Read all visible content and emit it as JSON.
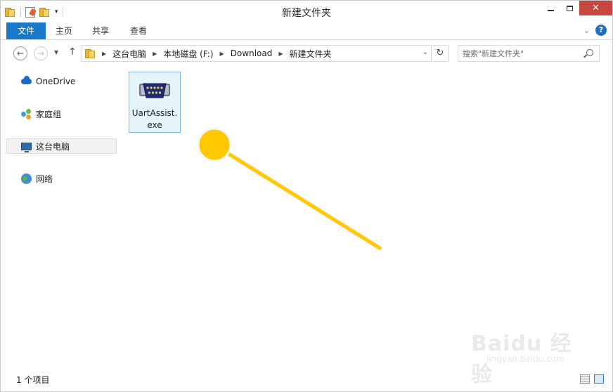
{
  "window": {
    "title": "新建文件夹"
  },
  "ribbon": {
    "tabs": [
      "文件",
      "主页",
      "共享",
      "查看"
    ],
    "help": "?"
  },
  "navigation": {
    "breadcrumbs": [
      "这台电脑",
      "本地磁盘 (F:)",
      "Download",
      "新建文件夹"
    ],
    "search_placeholder": "搜索\"新建文件夹\""
  },
  "sidebar": {
    "items": [
      {
        "label": "OneDrive",
        "icon": "onedrive-icon",
        "selected": false
      },
      {
        "label": "家庭组",
        "icon": "homegroup-icon",
        "selected": false
      },
      {
        "label": "这台电脑",
        "icon": "computer-icon",
        "selected": true
      },
      {
        "label": "网络",
        "icon": "network-icon",
        "selected": false
      }
    ]
  },
  "files": [
    {
      "name_line1": "UartAssist.",
      "name_line2": "exe",
      "icon": "serial-port-icon",
      "selected": true
    }
  ],
  "status": {
    "item_count": "1 个项目"
  },
  "watermark": {
    "brand": "Baidu 经验",
    "url": "jingyan.baidu.com"
  },
  "colors": {
    "accent": "#1979ca",
    "annotation": "#ffc800",
    "close_button": "#c7463d",
    "selection_fill": "#e5f3fb",
    "selection_border": "#7eb4ea"
  }
}
